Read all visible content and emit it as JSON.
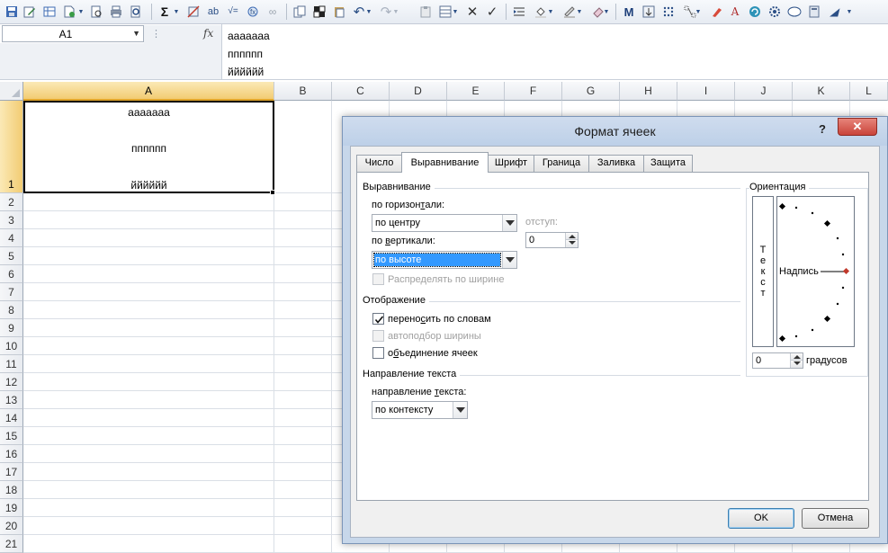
{
  "namebox": {
    "value": "A1"
  },
  "formula_bar": {
    "fx_label": "fx",
    "lines": [
      "ааааааа",
      "пппппп",
      "йййййй"
    ]
  },
  "grid": {
    "columns": [
      "A",
      "B",
      "C",
      "D",
      "E",
      "F",
      "G",
      "H",
      "I",
      "J",
      "K",
      "L"
    ],
    "rows": [
      "1",
      "2",
      "3",
      "4",
      "5",
      "6",
      "7",
      "8",
      "9",
      "10",
      "11",
      "12",
      "13",
      "14",
      "15",
      "16",
      "17",
      "18",
      "19",
      "20",
      "21"
    ],
    "selected_column": "A",
    "selected_row": "1",
    "cell_a1_lines": [
      "ааааааа",
      "пппппп",
      "йййййй"
    ]
  },
  "dialog": {
    "title": "Формат ячеек",
    "help": "?",
    "close": "✕",
    "tabs": [
      "Число",
      "Выравнивание",
      "Шрифт",
      "Граница",
      "Заливка",
      "Защита"
    ],
    "active_tab": "Выравнивание",
    "alignment": {
      "group_label": "Выравнивание",
      "horizontal_label_pre": "по горизон",
      "horizontal_label_u": "т",
      "horizontal_label_post": "али:",
      "horizontal_value": "по центру",
      "indent_label": "отступ:",
      "indent_value": "0",
      "vertical_label_pre": "по ",
      "vertical_label_u": "в",
      "vertical_label_post": "ертикали:",
      "vertical_value": "по высоте",
      "distribute_label": "Распределять по ширине"
    },
    "display": {
      "group_label": "Отображение",
      "wrap_label_pre": "перено",
      "wrap_label_u": "с",
      "wrap_label_post": "ить по словам",
      "wrap_checked": true,
      "shrink_label": "автоподбор ширины",
      "shrink_checked": false,
      "merge_label_pre": "о",
      "merge_label_u": "б",
      "merge_label_post": "ъединение ячеек",
      "merge_checked": false
    },
    "text_direction": {
      "group_label": "Направление текста",
      "direction_label_pre": "направление ",
      "direction_label_u": "т",
      "direction_label_post": "екста:",
      "direction_value": "по контексту"
    },
    "orientation": {
      "group_label": "Ориентация",
      "vertical_text": [
        "Т",
        "е",
        "к",
        "с",
        "т"
      ],
      "dial_label": "Надпись",
      "degrees_value": "0",
      "degrees_label": "градусов"
    },
    "ok_label": "OK",
    "cancel_label": "Отмена"
  },
  "colors": {
    "selection_header": "#f2cc73",
    "dialog_frame": "#c7d7ea",
    "focus_highlight": "#3399ff",
    "close_button": "#c9443a"
  }
}
